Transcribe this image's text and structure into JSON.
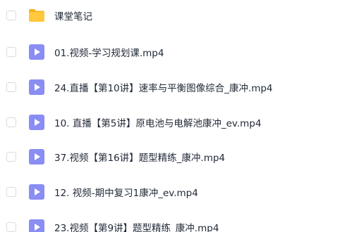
{
  "colors": {
    "folder": "#ffc83d",
    "folder_tab": "#f5b21a",
    "video": "#8a8df4",
    "text": "#222a38",
    "checkbox_border": "#d8dbe2"
  },
  "files": [
    {
      "type": "folder",
      "icon": "folder-icon",
      "name": "课堂笔记"
    },
    {
      "type": "video",
      "icon": "video-file-icon",
      "name": "01.视频-学习规划课.mp4"
    },
    {
      "type": "video",
      "icon": "video-file-icon",
      "name": "24.直播【第10讲】速率与平衡图像综合_康冲.mp4"
    },
    {
      "type": "video",
      "icon": "video-file-icon",
      "name": "10. 直播【第5讲】原电池与电解池康冲_ev.mp4"
    },
    {
      "type": "video",
      "icon": "video-file-icon",
      "name": "37.视频【第16讲】题型精练_康冲.mp4"
    },
    {
      "type": "video",
      "icon": "video-file-icon",
      "name": "12. 视频-期中复习1康冲_ev.mp4"
    },
    {
      "type": "video",
      "icon": "video-file-icon",
      "name": "23.视频【第9讲】题型精练_康冲.mp4"
    }
  ]
}
